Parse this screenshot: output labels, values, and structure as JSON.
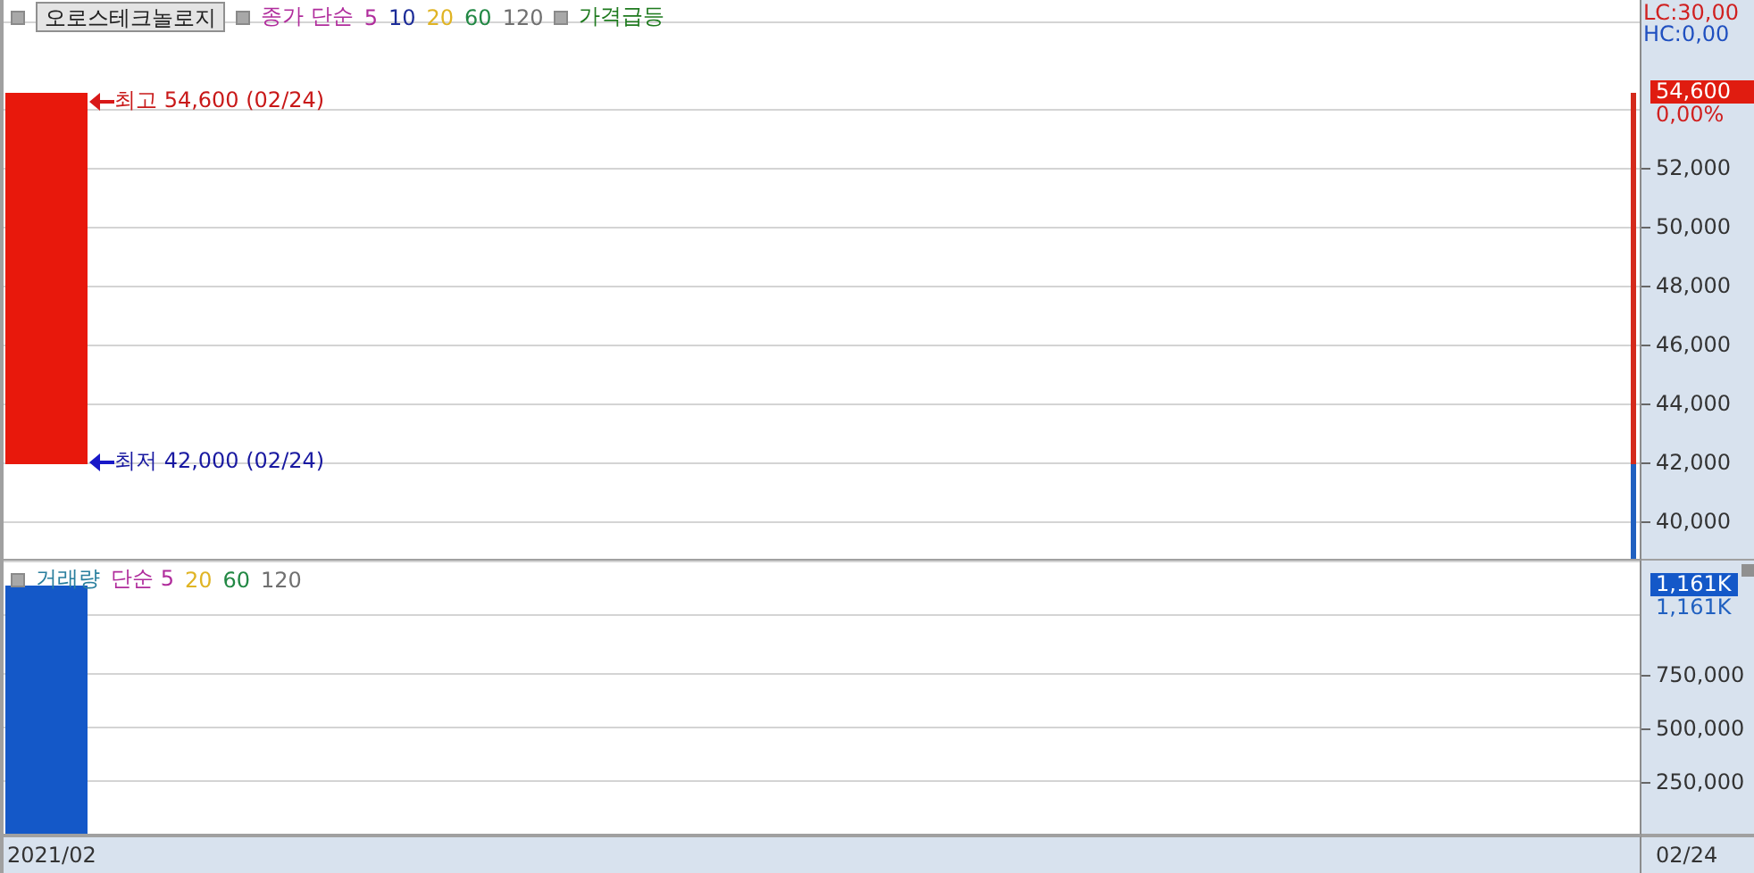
{
  "price_panel": {
    "stock_button": "오로스테크놀로지",
    "legend": [
      {
        "text": "종가 단순",
        "color": "#b02c9c"
      },
      {
        "text": "5",
        "color": "#b02c9c"
      },
      {
        "text": "10",
        "color": "#1c2c98"
      },
      {
        "text": "20",
        "color": "#e0b424"
      },
      {
        "text": "60",
        "color": "#228844"
      },
      {
        "text": "120",
        "color": "#707070"
      }
    ],
    "signal": {
      "text": "가격급등",
      "color": "#1e7a1e"
    },
    "high_note": "최고 54,600 (02/24)",
    "low_note": "최저 42,000 (02/24)",
    "lc": "LC:30,00",
    "hc": "HC:0,00",
    "current_price": "54,600",
    "change": "0,00%",
    "y_labels": [
      "52,000",
      "50,000",
      "48,000",
      "46,000",
      "44,000",
      "42,000",
      "40,000"
    ]
  },
  "volume_panel": {
    "legend": [
      {
        "text": "거래량",
        "color": "#2a7f9e"
      },
      {
        "text": "단순 5",
        "color": "#b02c9c"
      },
      {
        "text": "20",
        "color": "#e0b424"
      },
      {
        "text": "60",
        "color": "#228844"
      },
      {
        "text": "120",
        "color": "#707070"
      }
    ],
    "current_volume": "1,161K",
    "volume_reading": "1,161K",
    "y_labels": [
      "750,000",
      "500,000",
      "250,000"
    ]
  },
  "x_axis": {
    "period": "2021/02",
    "date": "02/24"
  }
}
